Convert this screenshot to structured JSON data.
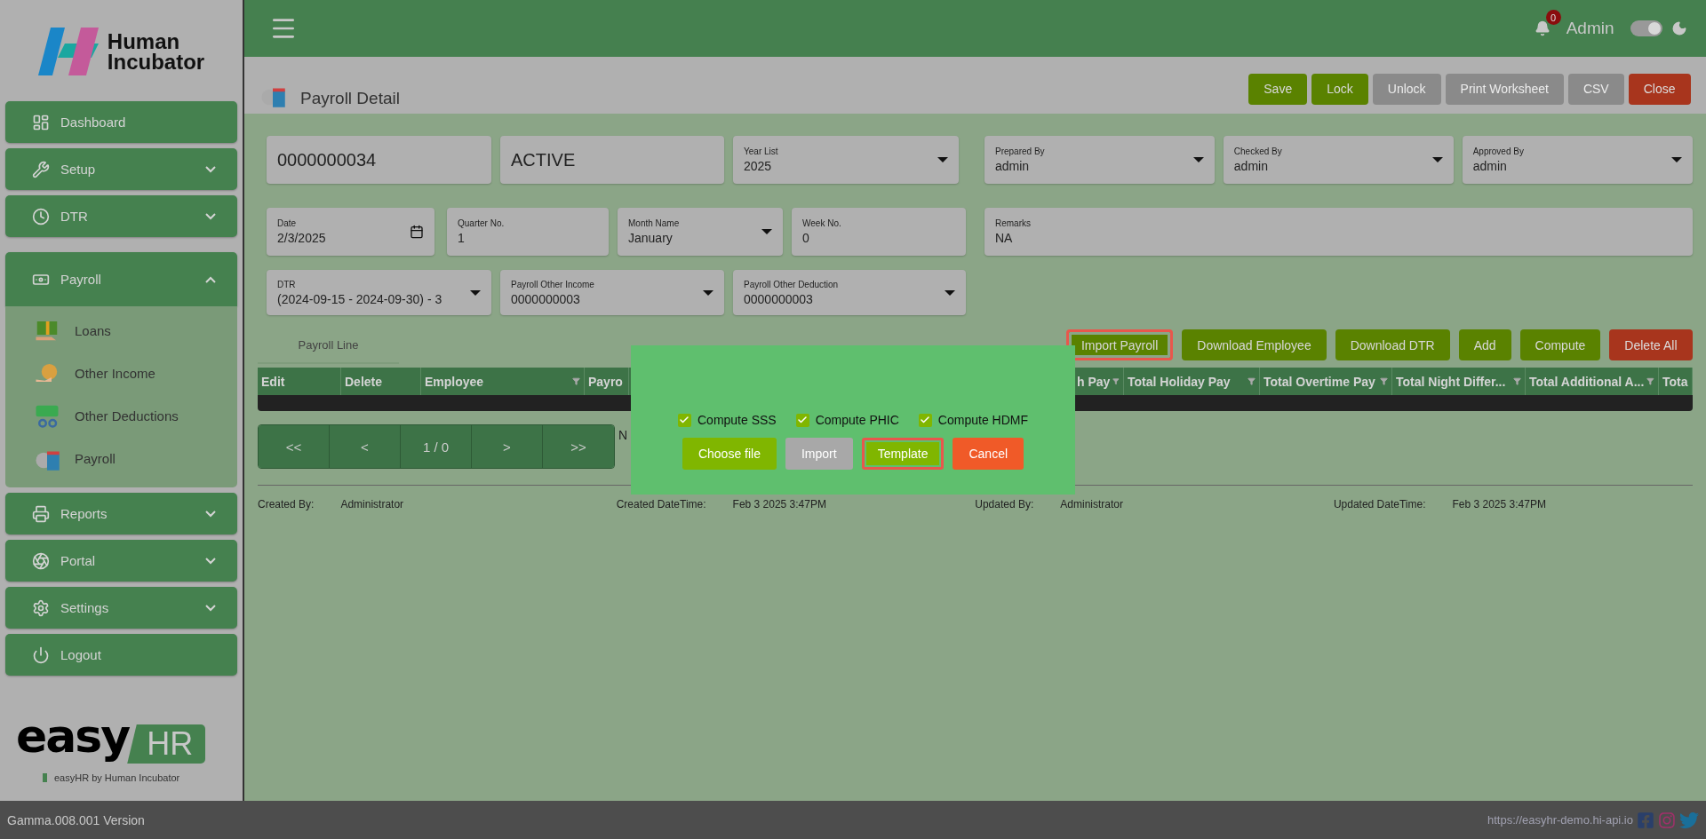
{
  "sidebar": {
    "logo": {
      "lines": [
        "Human",
        "Incubator"
      ]
    },
    "items": [
      {
        "kind": "link",
        "label": "Dashboard"
      },
      {
        "kind": "group",
        "label": "Setup",
        "expanded": false
      },
      {
        "kind": "group",
        "label": "DTR",
        "expanded": false
      },
      {
        "kind": "group",
        "label": "Payroll",
        "expanded": true,
        "children": [
          {
            "label": "Loans"
          },
          {
            "label": "Other Income"
          },
          {
            "label": "Other Deductions"
          },
          {
            "label": "Payroll"
          }
        ]
      },
      {
        "kind": "group",
        "label": "Reports",
        "expanded": false
      },
      {
        "kind": "group",
        "label": "Portal",
        "expanded": false
      },
      {
        "kind": "group",
        "label": "Settings",
        "expanded": false
      },
      {
        "kind": "link",
        "label": "Logout"
      }
    ],
    "brand": {
      "word": "easy",
      "badge": "HR",
      "tagline": "easyHR by Human Incubator"
    }
  },
  "topbar": {
    "notifications": "0",
    "user": "Admin",
    "theme_toggle_on": true
  },
  "page": {
    "title": "Payroll Detail",
    "actions": [
      {
        "label": "Save",
        "kind": "primary",
        "disabled": false
      },
      {
        "label": "Lock",
        "kind": "primary",
        "disabled": false
      },
      {
        "label": "Unlock",
        "kind": "primary",
        "disabled": true
      },
      {
        "label": "Print Worksheet",
        "kind": "primary",
        "disabled": true
      },
      {
        "label": "CSV",
        "kind": "primary",
        "disabled": true
      },
      {
        "label": "Close",
        "kind": "danger",
        "disabled": false
      }
    ]
  },
  "form": {
    "signoff": [
      [
        {
          "kind": "select",
          "label": "Prepared By",
          "value": "admin"
        },
        {
          "kind": "select",
          "label": "Checked By",
          "value": "admin"
        },
        {
          "kind": "select",
          "label": "Approved By",
          "value": "admin"
        }
      ],
      [
        {
          "kind": "text",
          "label": "Remarks",
          "value": "NA"
        }
      ]
    ],
    "rows": [
      [
        {
          "kind": "plain",
          "value": "0000000034"
        },
        {
          "kind": "plain",
          "value": "ACTIVE"
        },
        {
          "kind": "select",
          "label": "Year List",
          "value": "2025"
        }
      ],
      [
        {
          "kind": "date",
          "label": "Date",
          "value": "2/3/2025"
        },
        {
          "kind": "text",
          "label": "Quarter No.",
          "value": "1"
        },
        {
          "kind": "select",
          "label": "Month Name",
          "value": "January"
        },
        {
          "kind": "text",
          "label": "Week No.",
          "value": "0"
        }
      ],
      [
        {
          "kind": "select",
          "label": "DTR",
          "value": "(2024-09-15 - 2024-09-30) - 3"
        },
        {
          "kind": "select",
          "label": "Payroll Other Income",
          "value": "0000000003"
        },
        {
          "kind": "select",
          "label": "Payroll Other Deduction",
          "value": "0000000003"
        }
      ]
    ]
  },
  "tabs": [
    {
      "label": "Payroll Line",
      "selected": true
    }
  ],
  "line_actions": [
    {
      "label": "Import Payroll",
      "kind": "primary",
      "highlighted": true
    },
    {
      "label": "Download Employee",
      "kind": "primary",
      "highlighted": false
    },
    {
      "label": "Download DTR",
      "kind": "primary",
      "highlighted": false
    },
    {
      "label": "Add",
      "kind": "primary",
      "highlighted": false
    },
    {
      "label": "Compute",
      "kind": "primary",
      "highlighted": false
    },
    {
      "label": "Delete All",
      "kind": "danger",
      "highlighted": false
    }
  ],
  "table": {
    "columns": [
      {
        "label": "Edit",
        "filter": false
      },
      {
        "label": "Delete",
        "filter": false
      },
      {
        "label": "Employee",
        "filter": true
      },
      {
        "label": "Payro"
      },
      {
        "label": "h Pay",
        "filter": true
      },
      {
        "label": "Total Holiday Pay",
        "filter": true
      },
      {
        "label": "Total Overtime Pay",
        "filter": true
      },
      {
        "label": "Total Night Differ...",
        "filter": true
      },
      {
        "label": "Total Additional A...",
        "filter": true
      },
      {
        "label": "Tota"
      }
    ]
  },
  "pagination": {
    "buttons": [
      "<<",
      "<",
      "1 / 0",
      ">",
      ">>"
    ],
    "note": "N"
  },
  "audit": [
    {
      "label": "Created By:",
      "value": "Administrator"
    },
    {
      "label": "Created DateTime:",
      "value": "Feb 3 2025 3:47PM"
    },
    {
      "label": "Updated By:",
      "value": "Administrator"
    },
    {
      "label": "Updated DateTime:",
      "value": "Feb 3 2025 3:47PM"
    }
  ],
  "dialog": {
    "options": [
      {
        "label": "Compute SSS",
        "checked": true
      },
      {
        "label": "Compute PHIC",
        "checked": true
      },
      {
        "label": "Compute HDMF",
        "checked": true
      }
    ],
    "buttons": [
      {
        "label": "Choose file",
        "kind": "primary",
        "disabled": false,
        "highlighted": false
      },
      {
        "label": "Import",
        "kind": "primary",
        "disabled": true,
        "highlighted": false
      },
      {
        "label": "Template",
        "kind": "primary",
        "disabled": false,
        "highlighted": true
      },
      {
        "label": "Cancel",
        "kind": "danger",
        "disabled": false,
        "highlighted": false
      }
    ]
  },
  "footer": {
    "version": "Gamma.008.001 Version",
    "url": "https://easyhr-demo.hi-api.io"
  }
}
